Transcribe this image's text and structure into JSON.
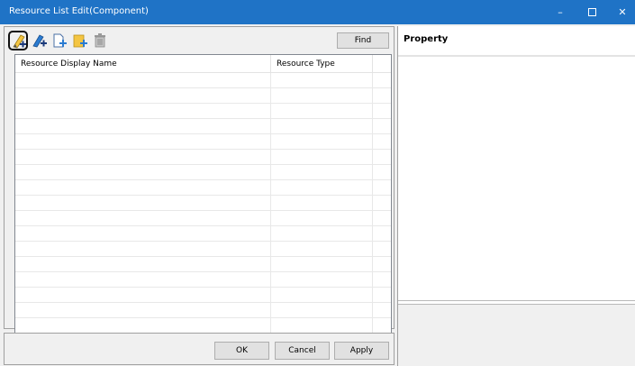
{
  "window": {
    "title": "Resource List Edit(Component)",
    "minimize_label": "–",
    "close_label": "✕"
  },
  "toolbar": {
    "find_label": "Find"
  },
  "grid": {
    "columns": [
      "Resource Display Name",
      "Resource Type"
    ]
  },
  "buttons": {
    "ok": "OK",
    "cancel": "Cancel",
    "apply": "Apply"
  },
  "property": {
    "title": "Property"
  },
  "colors": {
    "titlebar": "#1f73c6",
    "icon_yellow": "#f4c542",
    "icon_blue": "#2a7bd1"
  }
}
